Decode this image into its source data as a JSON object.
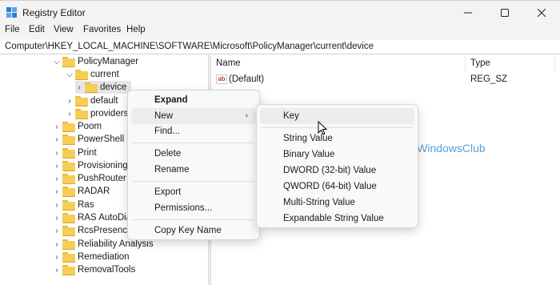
{
  "window": {
    "title": "Registry Editor"
  },
  "menu": [
    "File",
    "Edit",
    "View",
    "Favorites",
    "Help"
  ],
  "address": "Computer\\HKEY_LOCAL_MACHINE\\SOFTWARE\\Microsoft\\PolicyManager\\current\\device",
  "tree": [
    {
      "label": "PolicyManager",
      "chevron": "v"
    },
    {
      "label": "current",
      "chevron": "v"
    },
    {
      "label": "device",
      "chevron": ">"
    },
    {
      "label": "default",
      "chevron": ">"
    },
    {
      "label": "providers",
      "chevron": ">"
    },
    {
      "label": "Poom",
      "chevron": ">"
    },
    {
      "label": "PowerShell",
      "chevron": ">"
    },
    {
      "label": "Print",
      "chevron": ">"
    },
    {
      "label": "Provisioning",
      "chevron": ">"
    },
    {
      "label": "PushRouter",
      "chevron": ">"
    },
    {
      "label": "RADAR",
      "chevron": ">"
    },
    {
      "label": "Ras",
      "chevron": ">"
    },
    {
      "label": "RAS AutoDia",
      "chevron": ">"
    },
    {
      "label": "RcsPresence",
      "chevron": ">"
    },
    {
      "label": "Reliability Analysis",
      "chevron": ">"
    },
    {
      "label": "Remediation",
      "chevron": ">"
    },
    {
      "label": "RemovalTools",
      "chevron": ">"
    }
  ],
  "columns": {
    "name": "Name",
    "type": "Type"
  },
  "values": [
    {
      "name": "(Default)",
      "type": "REG_SZ",
      "icon": "ab"
    }
  ],
  "context_menu": {
    "expand": "Expand",
    "new": "New",
    "find": "Find...",
    "delete": "Delete",
    "rename": "Rename",
    "export": "Export",
    "permissions": "Permissions...",
    "copy_key_name": "Copy Key Name"
  },
  "submenu": {
    "key": "Key",
    "string": "String Value",
    "binary": "Binary Value",
    "dword": "DWORD (32-bit) Value",
    "qword": "QWORD (64-bit) Value",
    "multi": "Multi-String Value",
    "expand": "Expandable String Value"
  },
  "watermark": "TheWindowsClub",
  "colors": {
    "folder": "#f6cd55",
    "watermark": "#3b8fd2"
  }
}
